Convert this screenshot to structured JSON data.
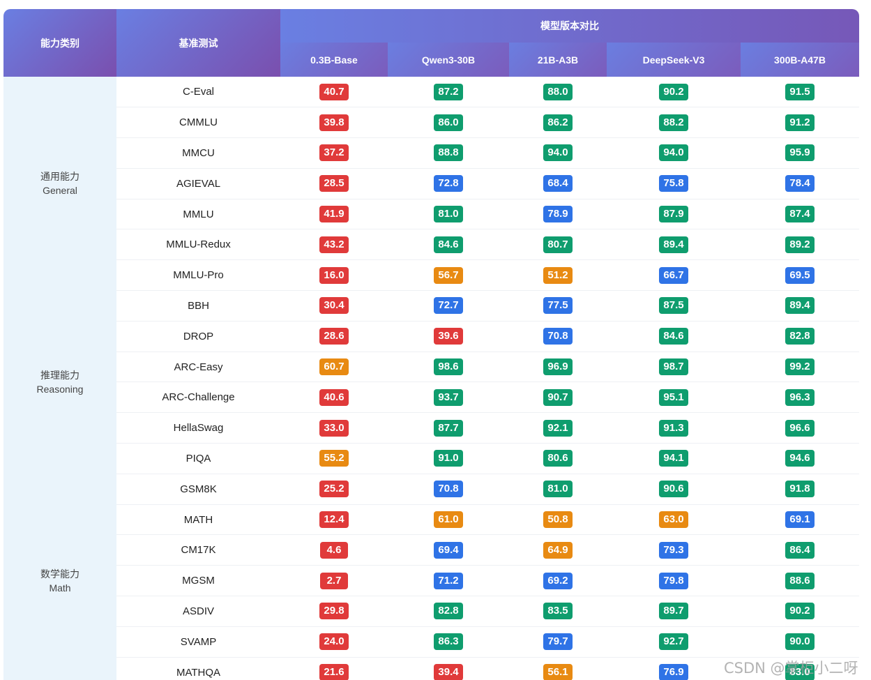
{
  "header": {
    "category": "能力类别",
    "benchmark": "基准测试",
    "group": "模型版本对比",
    "models": [
      "0.3B-Base",
      "Qwen3-30B",
      "21B-A3B",
      "DeepSeek-V3",
      "300B-A47B"
    ]
  },
  "categories": [
    {
      "cn": "通用能力",
      "en": "General",
      "rows": 7
    },
    {
      "cn": "推理能力",
      "en": "Reasoning",
      "rows": 6
    },
    {
      "cn": "数学能力",
      "en": "Math",
      "rows": 7
    }
  ],
  "rows": [
    {
      "bench": "C-Eval",
      "scores": [
        "40.7",
        "87.2",
        "88.0",
        "90.2",
        "91.5"
      ],
      "colors": [
        "red",
        "green",
        "green",
        "green",
        "green"
      ]
    },
    {
      "bench": "CMMLU",
      "scores": [
        "39.8",
        "86.0",
        "86.2",
        "88.2",
        "91.2"
      ],
      "colors": [
        "red",
        "green",
        "green",
        "green",
        "green"
      ]
    },
    {
      "bench": "MMCU",
      "scores": [
        "37.2",
        "88.8",
        "94.0",
        "94.0",
        "95.9"
      ],
      "colors": [
        "red",
        "green",
        "green",
        "green",
        "green"
      ]
    },
    {
      "bench": "AGIEVAL",
      "scores": [
        "28.5",
        "72.8",
        "68.4",
        "75.8",
        "78.4"
      ],
      "colors": [
        "red",
        "blue",
        "blue",
        "blue",
        "blue"
      ]
    },
    {
      "bench": "MMLU",
      "scores": [
        "41.9",
        "81.0",
        "78.9",
        "87.9",
        "87.4"
      ],
      "colors": [
        "red",
        "green",
        "blue",
        "green",
        "green"
      ]
    },
    {
      "bench": "MMLU-Redux",
      "scores": [
        "43.2",
        "84.6",
        "80.7",
        "89.4",
        "89.2"
      ],
      "colors": [
        "red",
        "green",
        "green",
        "green",
        "green"
      ]
    },
    {
      "bench": "MMLU-Pro",
      "scores": [
        "16.0",
        "56.7",
        "51.2",
        "66.7",
        "69.5"
      ],
      "colors": [
        "red",
        "orange",
        "orange",
        "blue",
        "blue"
      ]
    },
    {
      "bench": "BBH",
      "scores": [
        "30.4",
        "72.7",
        "77.5",
        "87.5",
        "89.4"
      ],
      "colors": [
        "red",
        "blue",
        "blue",
        "green",
        "green"
      ]
    },
    {
      "bench": "DROP",
      "scores": [
        "28.6",
        "39.6",
        "70.8",
        "84.6",
        "82.8"
      ],
      "colors": [
        "red",
        "red",
        "blue",
        "green",
        "green"
      ]
    },
    {
      "bench": "ARC-Easy",
      "scores": [
        "60.7",
        "98.6",
        "96.9",
        "98.7",
        "99.2"
      ],
      "colors": [
        "orange",
        "green",
        "green",
        "green",
        "green"
      ]
    },
    {
      "bench": "ARC-Challenge",
      "scores": [
        "40.6",
        "93.7",
        "90.7",
        "95.1",
        "96.3"
      ],
      "colors": [
        "red",
        "green",
        "green",
        "green",
        "green"
      ]
    },
    {
      "bench": "HellaSwag",
      "scores": [
        "33.0",
        "87.7",
        "92.1",
        "91.3",
        "96.6"
      ],
      "colors": [
        "red",
        "green",
        "green",
        "green",
        "green"
      ]
    },
    {
      "bench": "PIQA",
      "scores": [
        "55.2",
        "91.0",
        "80.6",
        "94.1",
        "94.6"
      ],
      "colors": [
        "orange",
        "green",
        "green",
        "green",
        "green"
      ]
    },
    {
      "bench": "GSM8K",
      "scores": [
        "25.2",
        "70.8",
        "81.0",
        "90.6",
        "91.8"
      ],
      "colors": [
        "red",
        "blue",
        "green",
        "green",
        "green"
      ]
    },
    {
      "bench": "MATH",
      "scores": [
        "12.4",
        "61.0",
        "50.8",
        "63.0",
        "69.1"
      ],
      "colors": [
        "red",
        "orange",
        "orange",
        "orange",
        "blue"
      ]
    },
    {
      "bench": "CM17K",
      "scores": [
        "4.6",
        "69.4",
        "64.9",
        "79.3",
        "86.4"
      ],
      "colors": [
        "red",
        "blue",
        "orange",
        "blue",
        "green"
      ]
    },
    {
      "bench": "MGSM",
      "scores": [
        "2.7",
        "71.2",
        "69.2",
        "79.8",
        "88.6"
      ],
      "colors": [
        "red",
        "blue",
        "blue",
        "blue",
        "green"
      ]
    },
    {
      "bench": "ASDIV",
      "scores": [
        "29.8",
        "82.8",
        "83.5",
        "89.7",
        "90.2"
      ],
      "colors": [
        "red",
        "green",
        "green",
        "green",
        "green"
      ]
    },
    {
      "bench": "SVAMP",
      "scores": [
        "24.0",
        "86.3",
        "79.7",
        "92.7",
        "90.0"
      ],
      "colors": [
        "red",
        "green",
        "blue",
        "green",
        "green"
      ]
    },
    {
      "bench": "MATHQA",
      "scores": [
        "21.6",
        "39.4",
        "56.1",
        "76.9",
        "83.0"
      ],
      "colors": [
        "red",
        "red",
        "orange",
        "blue",
        "green"
      ]
    }
  ],
  "badge_colors": {
    "red": "#e03a3a",
    "green": "#0f9d6e",
    "blue": "#2f73e6",
    "orange": "#e88a12"
  },
  "watermark": "CSDN @掌柜小二呀"
}
